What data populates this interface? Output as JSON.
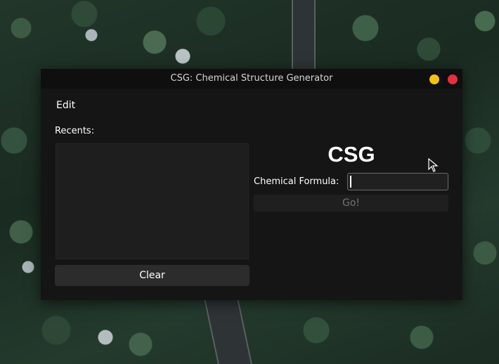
{
  "window": {
    "title": "CSG: Chemical Structure Generator"
  },
  "menu": {
    "edit_label": "Edit"
  },
  "recents": {
    "label": "Recents:",
    "items": [],
    "clear_label": "Clear"
  },
  "main": {
    "heading": "CSG",
    "formula_label": "Chemical Formula:",
    "formula_value": "",
    "go_label": "Go!"
  },
  "colors": {
    "minimize": "#f5c211",
    "close": "#e5303c",
    "window_bg": "#151515"
  }
}
